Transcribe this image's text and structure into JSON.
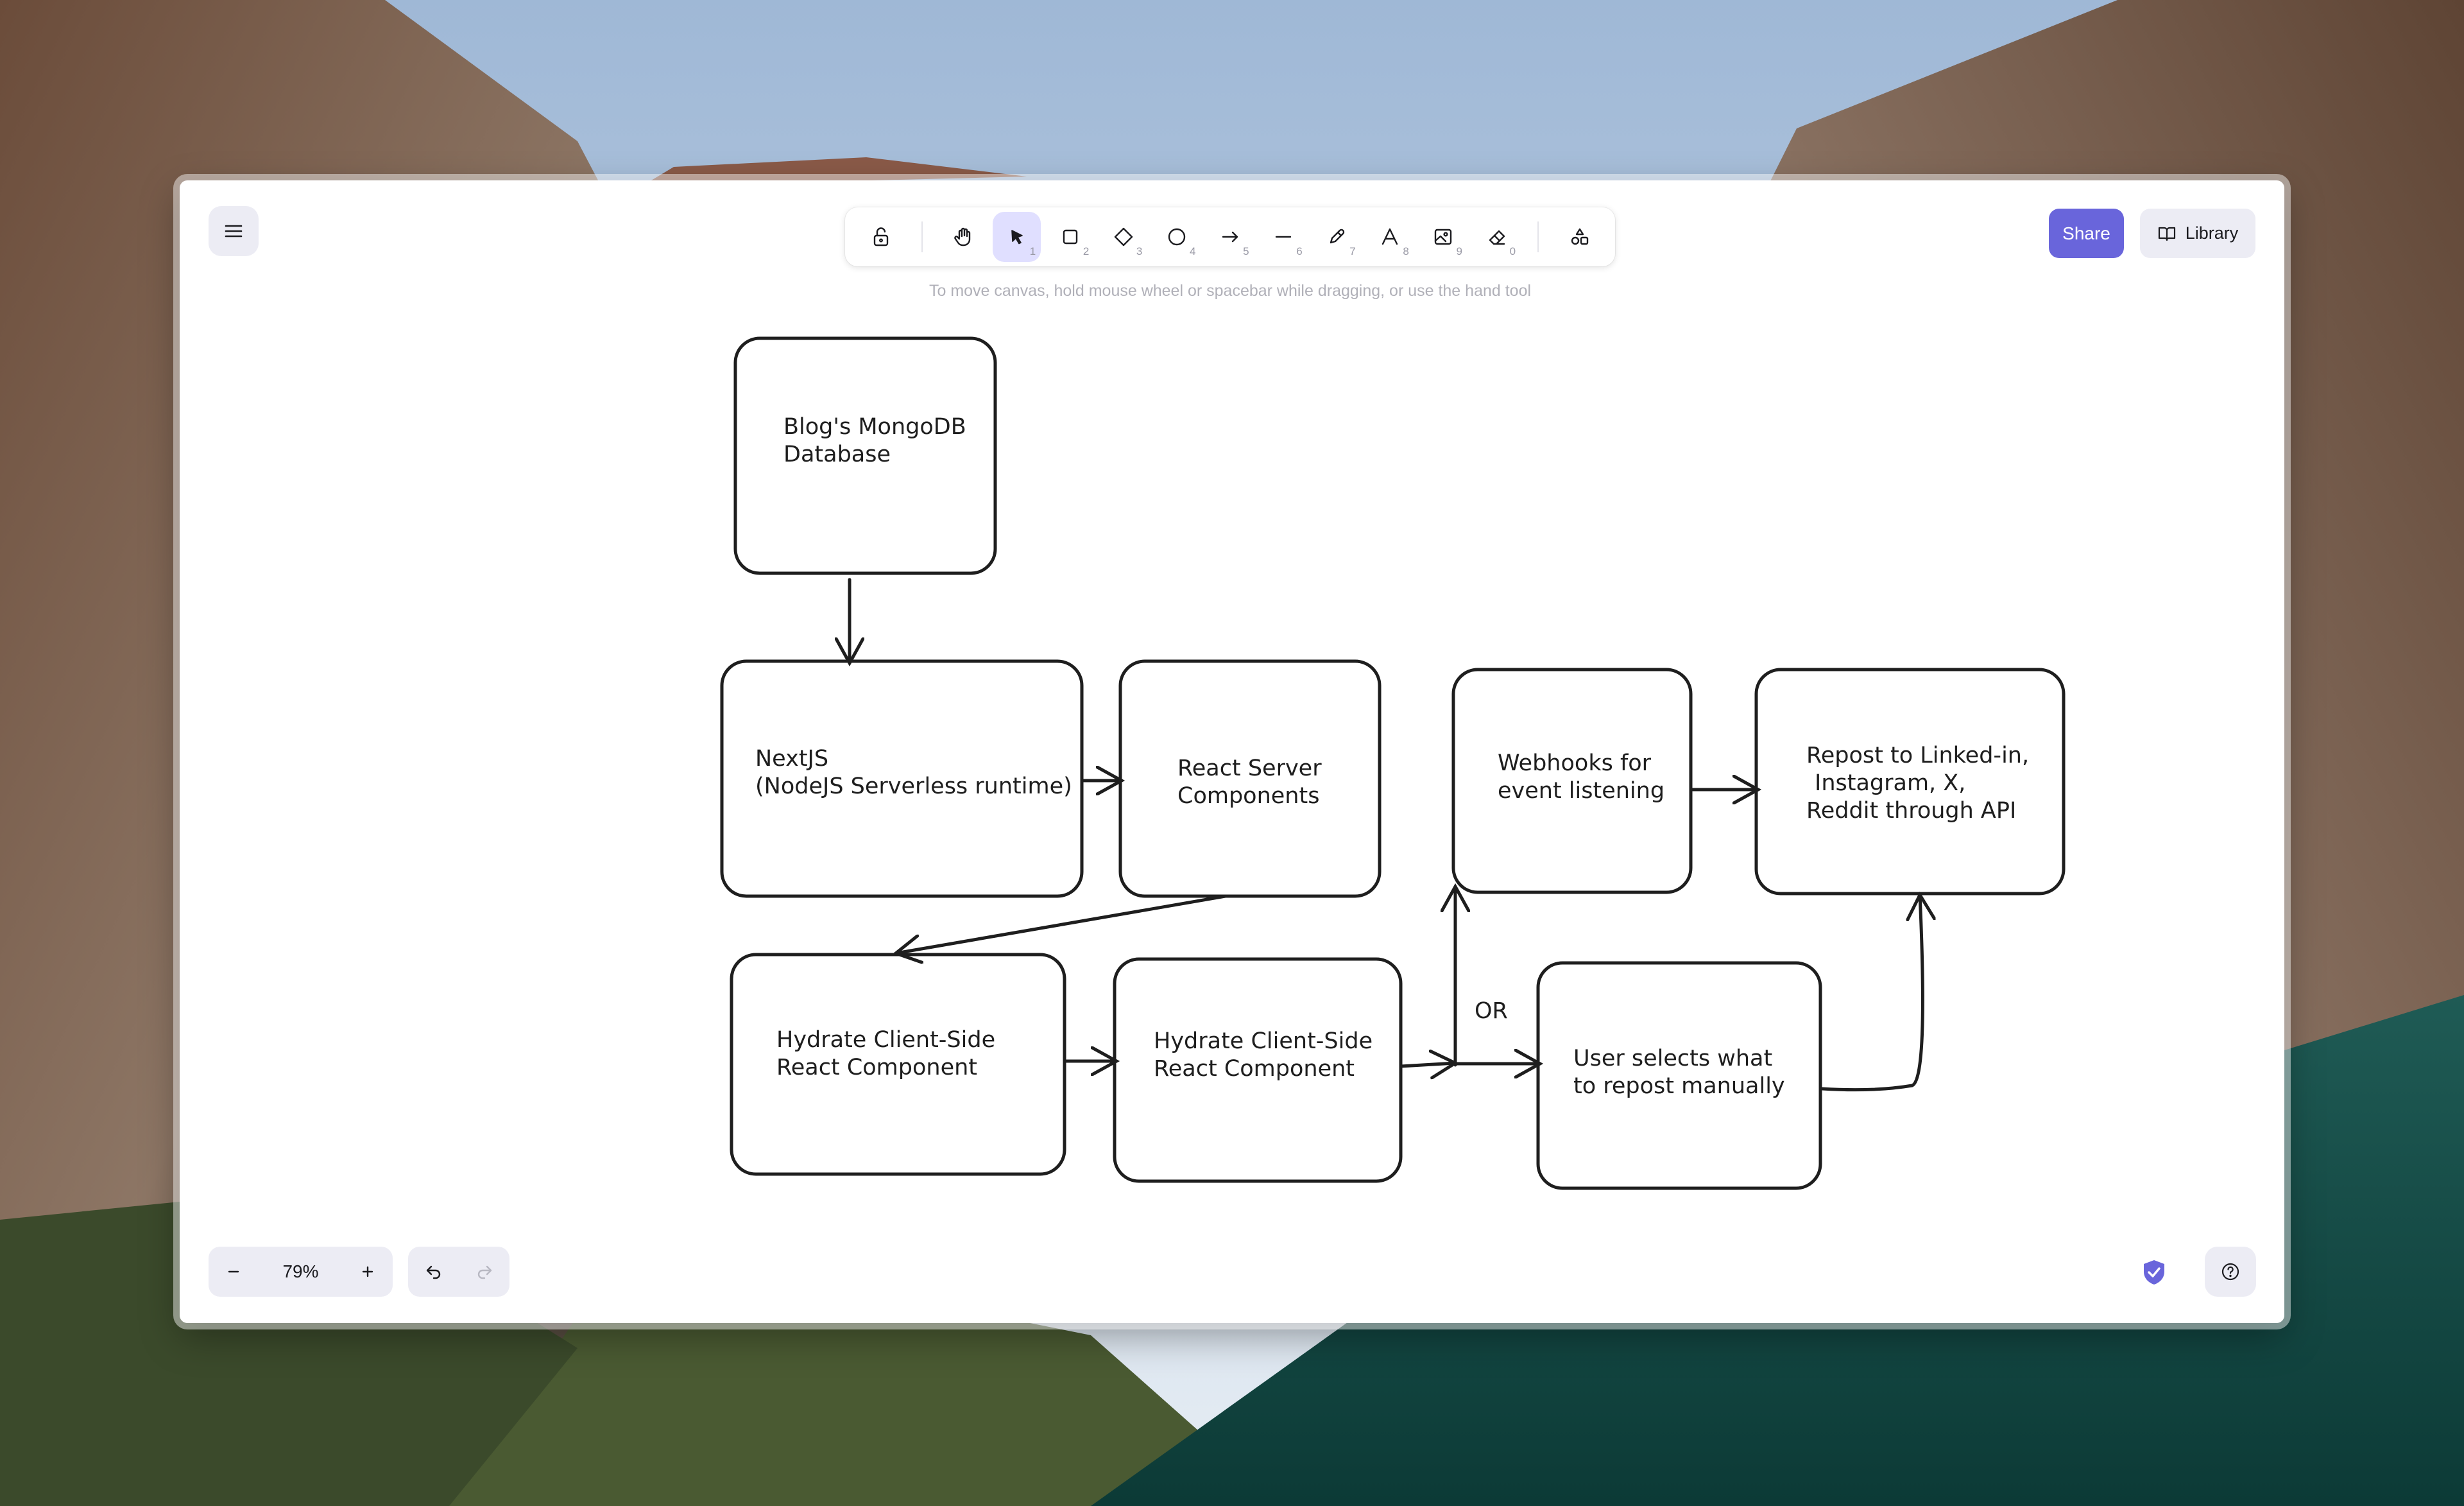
{
  "toolbar": {
    "tools": [
      {
        "name": "lock",
        "key": ""
      },
      {
        "name": "hand",
        "key": ""
      },
      {
        "name": "selection",
        "key": "1"
      },
      {
        "name": "rectangle",
        "key": "2"
      },
      {
        "name": "diamond",
        "key": "3"
      },
      {
        "name": "ellipse",
        "key": "4"
      },
      {
        "name": "arrow",
        "key": "5"
      },
      {
        "name": "line",
        "key": "6"
      },
      {
        "name": "draw",
        "key": "7"
      },
      {
        "name": "text",
        "key": "8"
      },
      {
        "name": "image",
        "key": "9"
      },
      {
        "name": "eraser",
        "key": "0"
      },
      {
        "name": "extra-tools",
        "key": ""
      }
    ],
    "active_tool": "selection"
  },
  "canvas_hint": "To move canvas, hold mouse wheel or spacebar while dragging, or use the hand tool",
  "share_label": "Share",
  "library_label": "Library",
  "zoom": {
    "level": "79%"
  },
  "colors": {
    "accent": "#6965db",
    "active_tool_bg": "#e0dfff",
    "panel_bg": "#ececf4",
    "stroke": "#1e1e1e"
  },
  "diagram": {
    "nodes": {
      "mongodb": [
        "Blog's MongoDB",
        "Database"
      ],
      "nextjs": [
        "NextJS",
        "(NodeJS Serverless runtime)"
      ],
      "rsc": [
        "React Server",
        "Components"
      ],
      "hydrate1": [
        "Hydrate Client-Side",
        "React Component"
      ],
      "hydrate2": [
        "Hydrate Client-Side",
        "React Component"
      ],
      "webhooks": [
        "Webhooks for",
        "event listening"
      ],
      "repost": [
        "Repost to Linked-in,",
        "Instagram, X,",
        "Reddit through API"
      ],
      "manual": [
        "User selects what",
        "to repost manually"
      ]
    },
    "or_label": "OR"
  }
}
